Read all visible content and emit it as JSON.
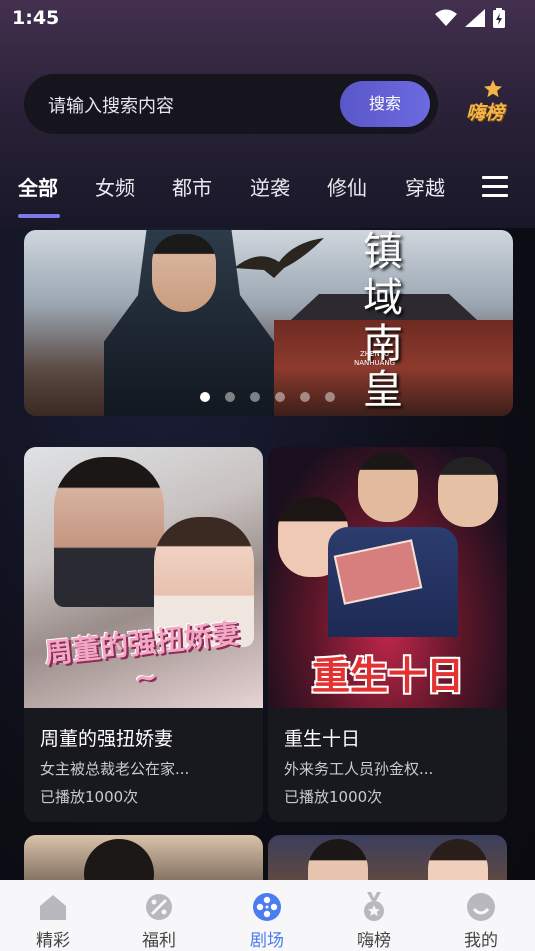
{
  "status_bar": {
    "time": "1:45"
  },
  "search": {
    "placeholder": "请输入搜索内容",
    "button_label": "搜索"
  },
  "hai_bang_label": "嗨榜",
  "tabs": [
    {
      "label": "全部",
      "active": true
    },
    {
      "label": "女频"
    },
    {
      "label": "都市"
    },
    {
      "label": "逆袭"
    },
    {
      "label": "修仙"
    },
    {
      "label": "穿越"
    }
  ],
  "banner": {
    "title": "镇域南皇",
    "subtitle_line1": "ZHENYU",
    "subtitle_line2": "NANHUANG",
    "active_slide": 1,
    "slide_count": 6
  },
  "cards": [
    {
      "title": "周董的强扭娇妻",
      "description": "女主被总裁老公在家...",
      "plays": "已播放1000次",
      "poster_text": "周董的强扭娇妻~"
    },
    {
      "title": "重生十日",
      "description": "外来务工人员孙金权...",
      "plays": "已播放1000次",
      "poster_text": "重生十日"
    }
  ],
  "bottom_nav": [
    {
      "label": "精彩",
      "icon": "home-icon"
    },
    {
      "label": "福利",
      "icon": "gift-icon"
    },
    {
      "label": "剧场",
      "icon": "film-reel-icon",
      "active": true
    },
    {
      "label": "嗨榜",
      "icon": "medal-icon"
    },
    {
      "label": "我的",
      "icon": "profile-icon"
    }
  ],
  "colors": {
    "accent": "#6c6ae0",
    "nav_active": "#4b7cf0",
    "hai_bang": "#f4b548"
  }
}
